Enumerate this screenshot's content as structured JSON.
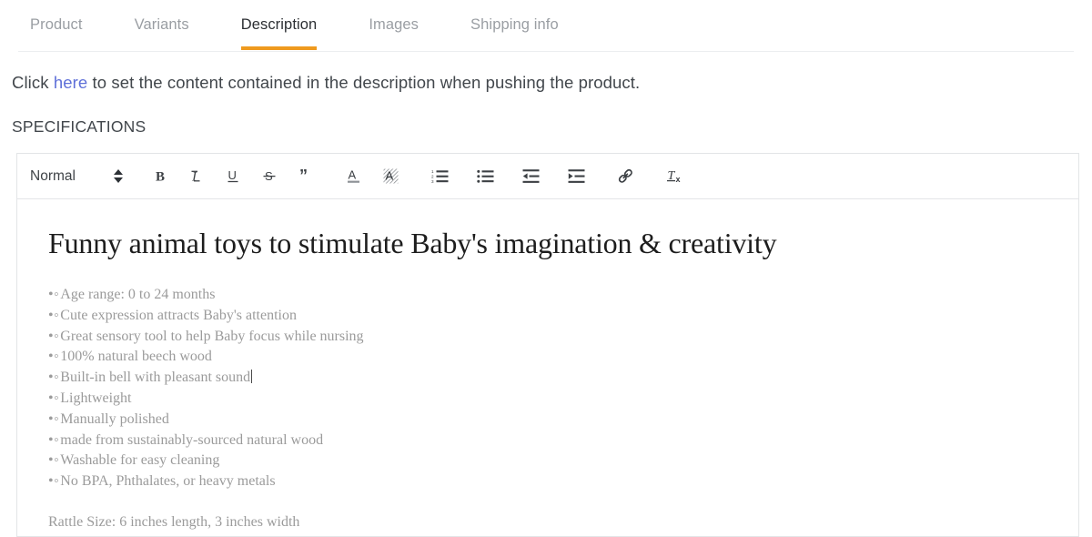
{
  "tabs": [
    {
      "label": "Product",
      "active": false
    },
    {
      "label": "Variants",
      "active": false
    },
    {
      "label": "Description",
      "active": true
    },
    {
      "label": "Images",
      "active": false
    },
    {
      "label": "Shipping info",
      "active": false
    }
  ],
  "intro": {
    "before": "Click ",
    "link": "here",
    "after": " to set the content contained in the description when pushing the product."
  },
  "section": {
    "specifications_label": "SPECIFICATIONS"
  },
  "editor": {
    "toolbar": {
      "format_select": {
        "value": "Normal",
        "icon": "updown-chevron-icon"
      },
      "buttons": [
        {
          "name": "bold-button",
          "label": "B",
          "icon": "bold-icon"
        },
        {
          "name": "italic-button",
          "label": "I",
          "icon": "italic-icon"
        },
        {
          "name": "underline-button",
          "label": "U",
          "icon": "underline-icon"
        },
        {
          "name": "strikethrough-button",
          "label": "S",
          "icon": "strikethrough-icon"
        },
        {
          "name": "blockquote-button",
          "label": "”",
          "icon": "quote-icon"
        },
        {
          "name": "text-color-button",
          "label": "A",
          "icon": "text-color-icon"
        },
        {
          "name": "background-color-button",
          "label": "A",
          "icon": "background-color-icon"
        },
        {
          "name": "ordered-list-button",
          "label": "",
          "icon": "ordered-list-icon"
        },
        {
          "name": "bullet-list-button",
          "label": "",
          "icon": "bullet-list-icon"
        },
        {
          "name": "outdent-button",
          "label": "",
          "icon": "outdent-icon"
        },
        {
          "name": "indent-button",
          "label": "",
          "icon": "indent-icon"
        },
        {
          "name": "link-button",
          "label": "",
          "icon": "link-icon"
        },
        {
          "name": "clear-format-button",
          "label": "Tx",
          "icon": "clear-formatting-icon"
        }
      ]
    },
    "document": {
      "title": "Funny animal toys to stimulate Baby's imagination & creativity",
      "bullet_marker": "•◦",
      "items": [
        "Age range: 0 to 24 months",
        "Cute expression attracts Baby's attention",
        "Great sensory tool to help Baby focus while nursing",
        "100% natural beech wood",
        "Built-in bell with pleasant sound",
        "Lightweight",
        "Manually polished",
        "made from sustainably-sourced natural wood",
        "Washable for easy cleaning",
        "No BPA, Phthalates, or heavy metals"
      ],
      "caret_after_item_index": 4,
      "footer_line": "Rattle Size: 6 inches length, 3 inches width"
    }
  },
  "colors": {
    "accent": "#ef9a1e",
    "link": "#5f70d8",
    "tab_inactive": "#9a9ea3",
    "tab_active": "#2c2f33",
    "body_text": "#42474c",
    "editor_text": "#9b9b9b",
    "border": "#e3e5e7"
  }
}
